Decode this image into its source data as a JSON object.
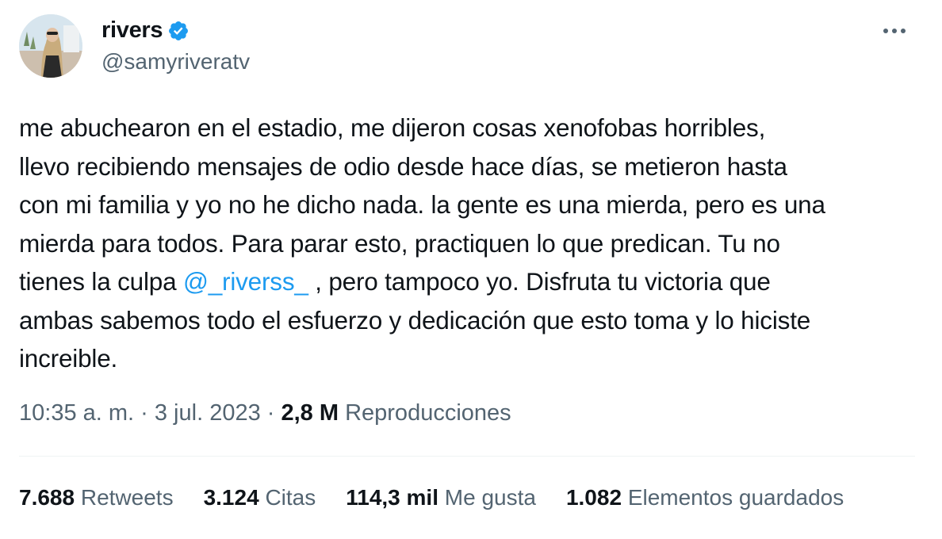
{
  "author": {
    "display_name": "rivers",
    "handle": "@samyriveratv",
    "avatar_icon": "avatar-photo",
    "verified_icon": "verified-badge-icon",
    "verified_color": "#1d9bf0"
  },
  "more_icon": "more-horizontal-icon",
  "tweet": {
    "text_before_mention": "me abuchearon en el estadio, me dijeron cosas xenofobas horribles,\nllevo recibiendo mensajes de odio desde hace días, se metieron hasta\ncon mi familia y yo no he dicho nada. la gente es una mierda, pero es una\nmierda para todos. Para parar esto, practiquen lo que predican. Tu no\ntienes la culpa ",
    "mention": "@_riverss_",
    "text_after_mention": " , pero tampoco yo. Disfruta tu victoria que\nambas sabemos todo el esfuerzo y dedicación que esto toma y lo hiciste\nincreible."
  },
  "meta": {
    "time": "10:35 a. m.",
    "separator": " · ",
    "date": "3 jul. 2023",
    "views_count": "2,8 M",
    "views_label": "Reproducciones"
  },
  "stats": {
    "retweets_count": "7.688",
    "retweets_label": "Retweets",
    "quotes_count": "3.124",
    "quotes_label": "Citas",
    "likes_count": "114,3 mil",
    "likes_label": "Me gusta",
    "bookmarks_count": "1.082",
    "bookmarks_label": "Elementos guardados"
  },
  "colors": {
    "text": "#0f1419",
    "secondary": "#536471",
    "link": "#1d9bf0",
    "divider": "#eff3f4"
  }
}
